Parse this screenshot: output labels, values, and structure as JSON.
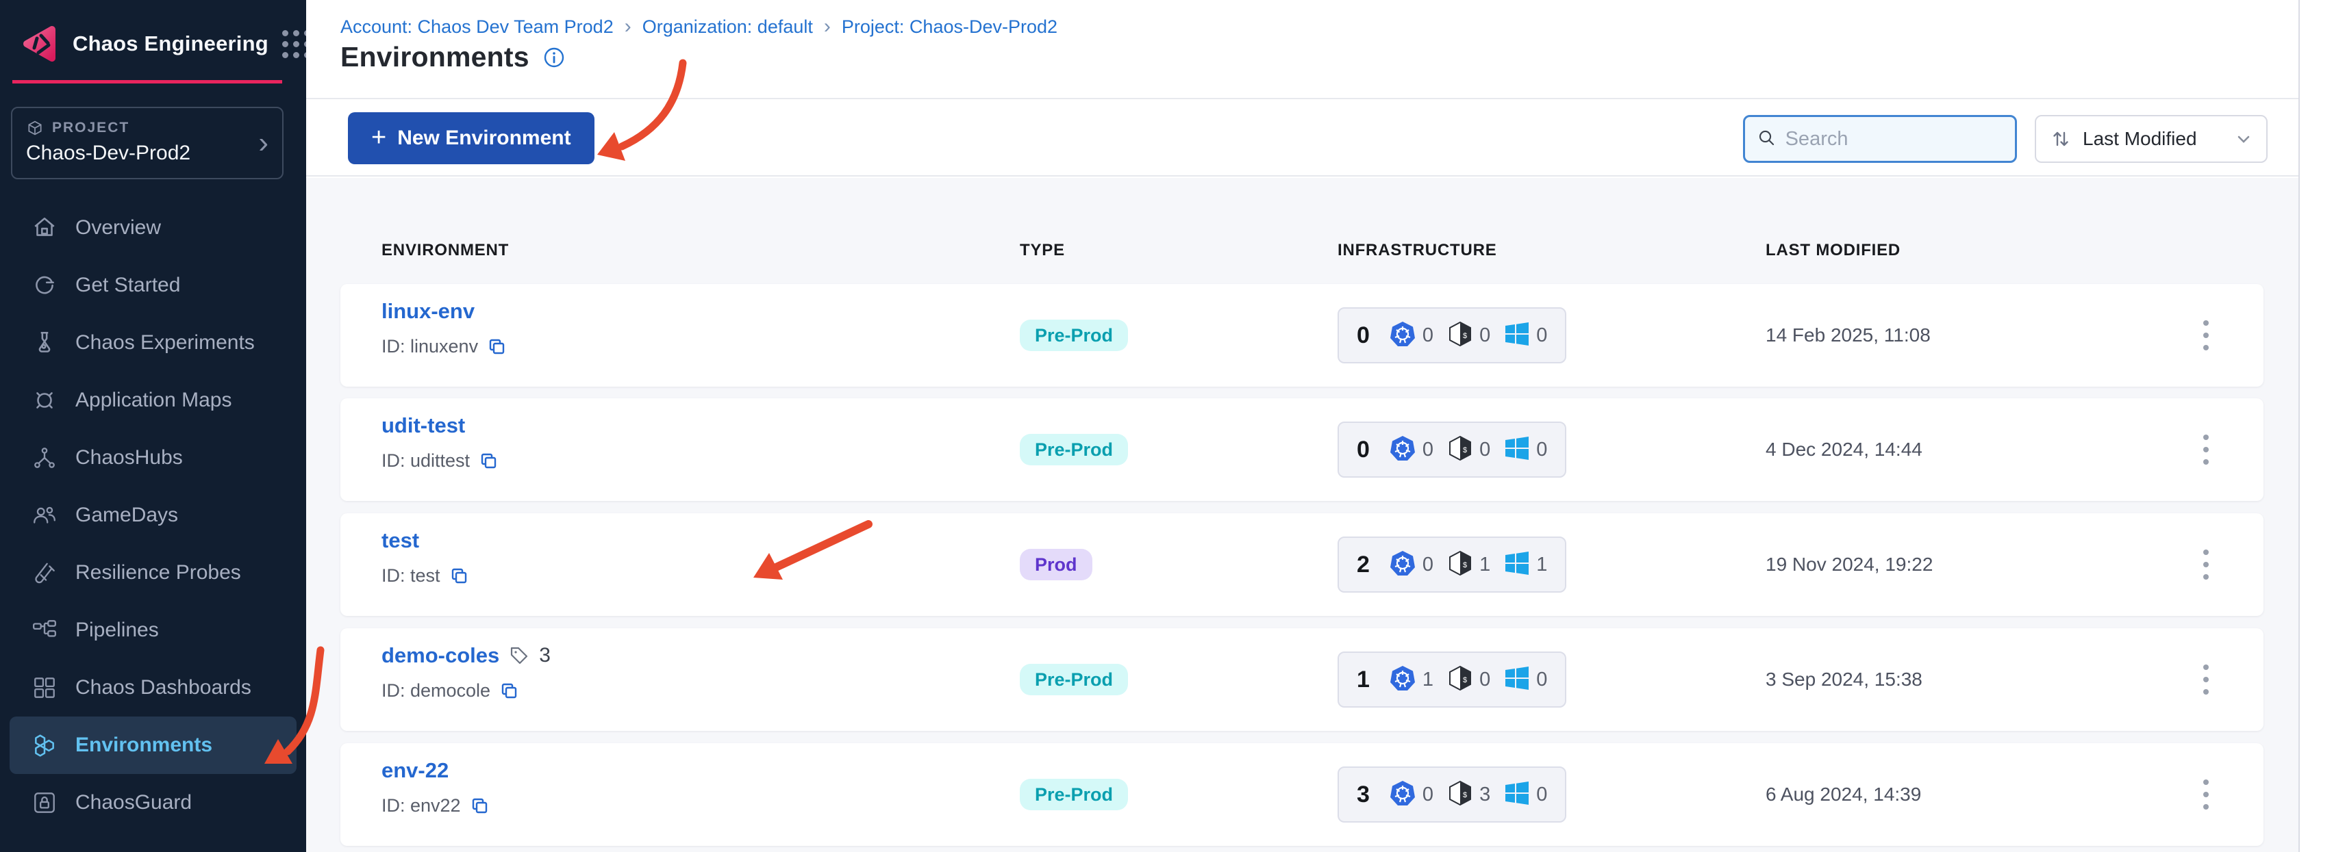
{
  "sidebar": {
    "product": "Chaos Engineering",
    "project_label": "PROJECT",
    "project_name": "Chaos-Dev-Prod2",
    "items": [
      {
        "label": "Overview",
        "icon": "home-icon"
      },
      {
        "label": "Get Started",
        "icon": "get-started-icon"
      },
      {
        "label": "Chaos Experiments",
        "icon": "flask-icon"
      },
      {
        "label": "Application Maps",
        "icon": "target-icon"
      },
      {
        "label": "ChaosHubs",
        "icon": "network-icon"
      },
      {
        "label": "GameDays",
        "icon": "people-icon"
      },
      {
        "label": "Resilience Probes",
        "icon": "test-tube-icon"
      },
      {
        "label": "Pipelines",
        "icon": "pipeline-icon"
      },
      {
        "label": "Chaos Dashboards",
        "icon": "dashboard-icon"
      },
      {
        "label": "Environments",
        "icon": "hexagons-icon"
      },
      {
        "label": "ChaosGuard",
        "icon": "lock-icon"
      }
    ],
    "active_item": "Environments"
  },
  "breadcrumb": {
    "account": "Account: Chaos Dev Team Prod2",
    "separator": "›",
    "organization": "Organization: default",
    "project": "Project: Chaos-Dev-Prod2"
  },
  "page": {
    "title": "Environments"
  },
  "toolbar": {
    "plus_glyph": "+",
    "new_environment_label": "New Environment",
    "search_placeholder": "Search",
    "sort_label": "Last Modified"
  },
  "table": {
    "columns": [
      "ENVIRONMENT",
      "TYPE",
      "INFRASTRUCTURE",
      "LAST MODIFIED"
    ],
    "rows": [
      {
        "name": "linux-env",
        "id_label": "ID: linuxenv",
        "type": "Pre-Prod",
        "total": "0",
        "k8s": "0",
        "linux": "0",
        "windows": "0",
        "modified": "14 Feb 2025, 11:08"
      },
      {
        "name": "udit-test",
        "id_label": "ID: udittest",
        "type": "Pre-Prod",
        "total": "0",
        "k8s": "0",
        "linux": "0",
        "windows": "0",
        "modified": "4 Dec 2024, 14:44"
      },
      {
        "name": "test",
        "id_label": "ID: test",
        "type": "Prod",
        "total": "2",
        "k8s": "0",
        "linux": "1",
        "windows": "1",
        "modified": "19 Nov 2024, 19:22"
      },
      {
        "name": "demo-coles",
        "tag_count": "3",
        "id_label": "ID: democole",
        "type": "Pre-Prod",
        "total": "1",
        "k8s": "1",
        "linux": "0",
        "windows": "0",
        "modified": "3 Sep 2024, 15:38"
      },
      {
        "name": "env-22",
        "id_label": "ID: env22",
        "type": "Pre-Prod",
        "total": "3",
        "k8s": "0",
        "linux": "3",
        "windows": "0",
        "modified": "6 Aug 2024, 14:39"
      }
    ]
  },
  "colors": {
    "sidebar_bg": "#111e30",
    "accent_pink": "#e8255e",
    "active_nav": "#62c1f0",
    "primary_button": "#2150af",
    "link_blue": "#2467cf",
    "preprod_bg": "#d5f9f8",
    "preprod_text": "#0a9faf",
    "prod_bg": "#e4dbfa",
    "prod_text": "#5e35cc",
    "annotation_arrow": "#e84a2e"
  }
}
